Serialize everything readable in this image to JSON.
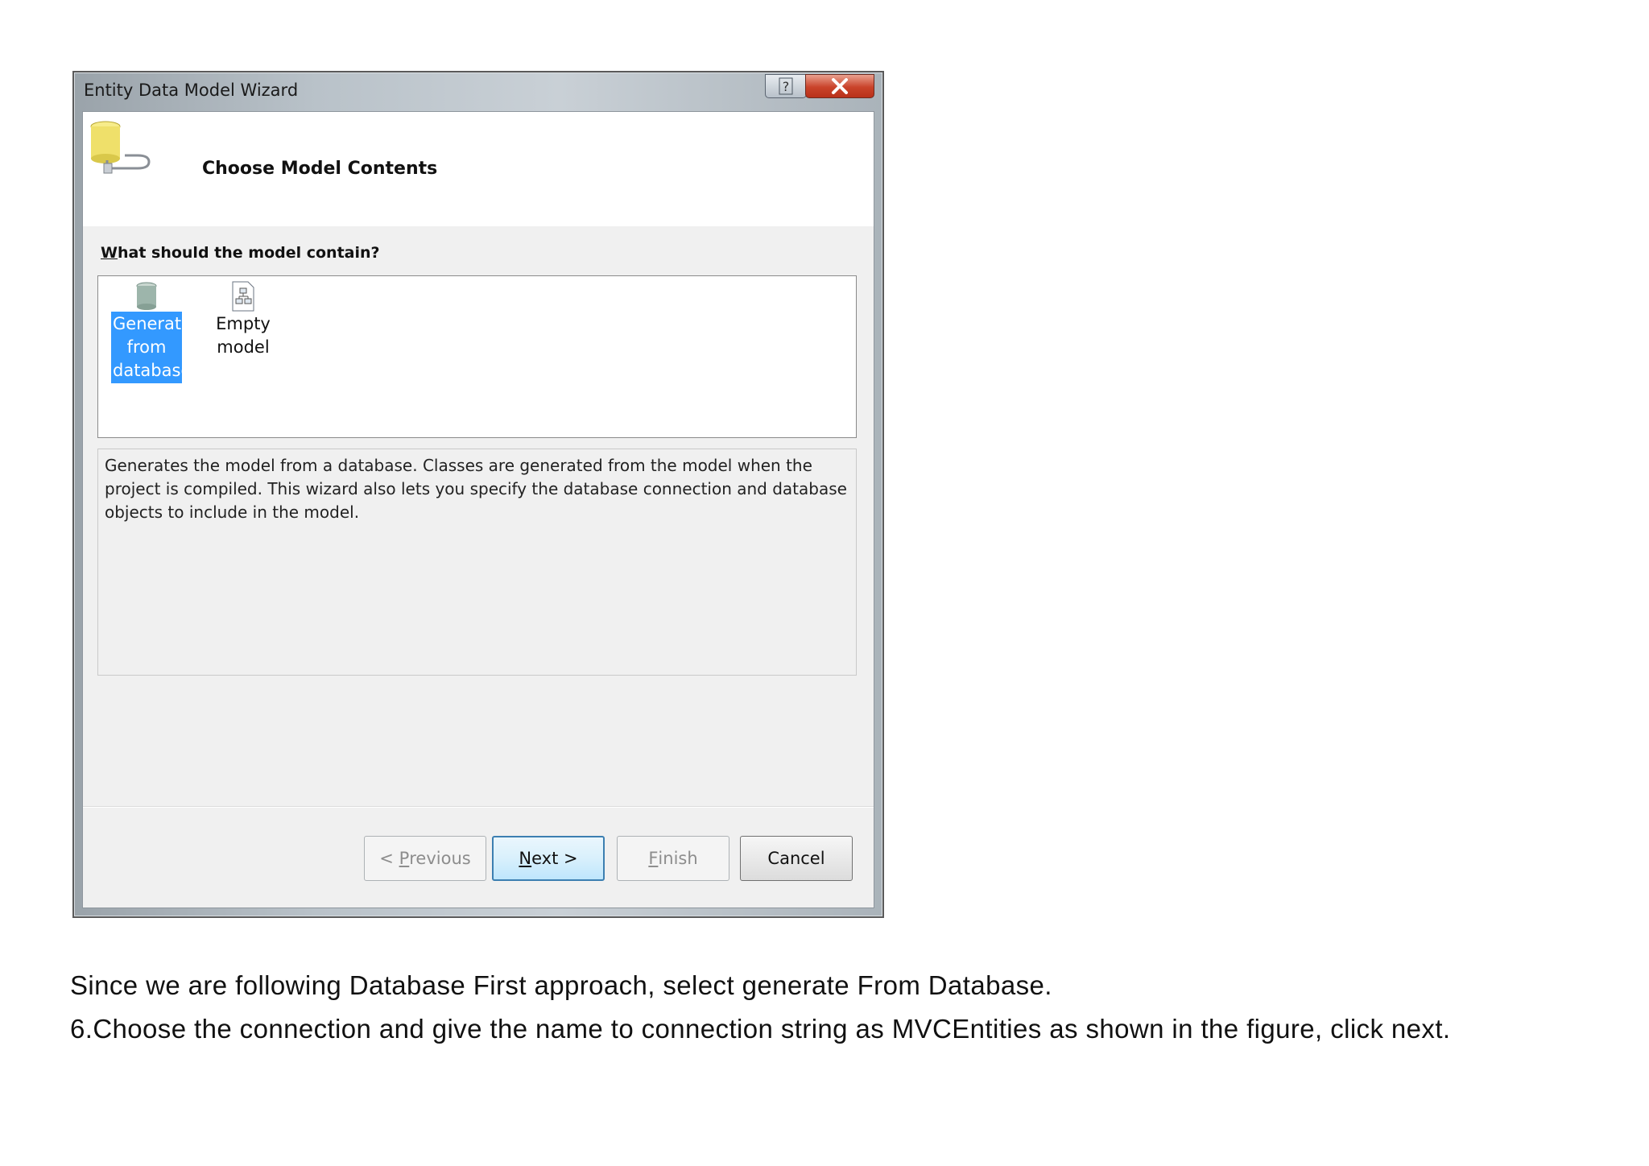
{
  "window": {
    "title": "Entity Data Model Wizard",
    "help_icon": "help-icon",
    "close_icon": "close-icon"
  },
  "header": {
    "heading": "Choose Model Contents",
    "logo_icon": "database-plug-icon"
  },
  "question": {
    "mnemonic": "W",
    "rest": "hat should the model contain?"
  },
  "model_options": [
    {
      "label": "Generate from database",
      "lines": [
        "Generate",
        "from",
        "database"
      ],
      "icon": "database-cylinder-icon",
      "selected": true
    },
    {
      "label": "Empty model",
      "lines": [
        "Empty",
        "model"
      ],
      "icon": "empty-model-document-icon",
      "selected": false
    }
  ],
  "description": "Generates the model from a database. Classes are generated from the model when the project is compiled. This wizard also lets you specify the database connection and database objects to include in the model.",
  "buttons": {
    "previous": {
      "prefix": "< ",
      "mnemonic": "P",
      "rest": "revious",
      "enabled": false
    },
    "next": {
      "mnemonic": "N",
      "rest": "ext >",
      "enabled": true,
      "default": true
    },
    "finish": {
      "mnemonic": "F",
      "rest": "inish",
      "enabled": false
    },
    "cancel": {
      "label": "Cancel",
      "enabled": true
    }
  },
  "document": {
    "line1": "Since we are following Database First approach, select generate From Database.",
    "line2": "6.Choose the connection and give the name to connection string as MVCEntities as shown in the figure, click next."
  },
  "colors": {
    "selection": "#3399ff",
    "close_button": "#c9432a",
    "default_button_border": "#3c7fb1"
  }
}
